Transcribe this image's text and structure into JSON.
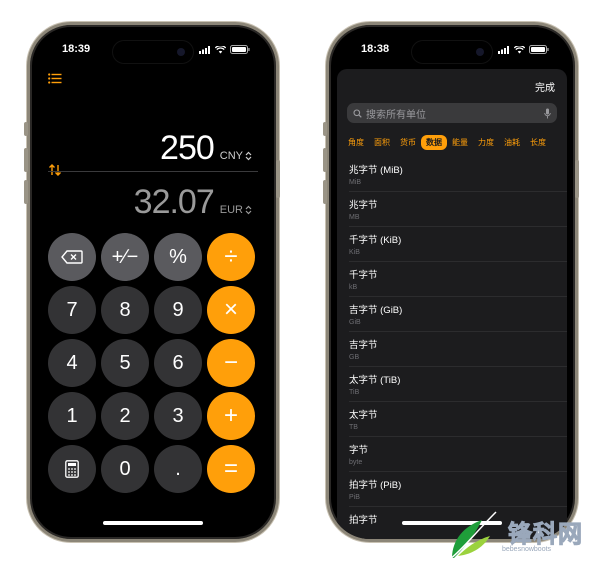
{
  "left_phone": {
    "status": {
      "time": "18:39"
    },
    "converter": {
      "source": {
        "value": "250",
        "currency": "CNY"
      },
      "target": {
        "value": "32.07",
        "currency": "EUR"
      }
    },
    "keypad": [
      {
        "label": "⌫",
        "name": "backspace-key",
        "style": "k-light"
      },
      {
        "label": "+∕−",
        "name": "plus-minus-key",
        "style": "k-light"
      },
      {
        "label": "%",
        "name": "percent-key",
        "style": "k-light"
      },
      {
        "label": "÷",
        "name": "divide-key",
        "style": "k-orange"
      },
      {
        "label": "7",
        "name": "digit-7-key",
        "style": "k-dark"
      },
      {
        "label": "8",
        "name": "digit-8-key",
        "style": "k-dark"
      },
      {
        "label": "9",
        "name": "digit-9-key",
        "style": "k-dark"
      },
      {
        "label": "×",
        "name": "multiply-key",
        "style": "k-orange"
      },
      {
        "label": "4",
        "name": "digit-4-key",
        "style": "k-dark"
      },
      {
        "label": "5",
        "name": "digit-5-key",
        "style": "k-dark"
      },
      {
        "label": "6",
        "name": "digit-6-key",
        "style": "k-dark"
      },
      {
        "label": "−",
        "name": "minus-key",
        "style": "k-orange"
      },
      {
        "label": "1",
        "name": "digit-1-key",
        "style": "k-dark"
      },
      {
        "label": "2",
        "name": "digit-2-key",
        "style": "k-dark"
      },
      {
        "label": "3",
        "name": "digit-3-key",
        "style": "k-dark"
      },
      {
        "label": "+",
        "name": "plus-key",
        "style": "k-orange"
      },
      {
        "label": "calculator-icon",
        "name": "calculator-mode-key",
        "style": "k-dark"
      },
      {
        "label": "0",
        "name": "digit-0-key",
        "style": "k-dark"
      },
      {
        "label": ".",
        "name": "decimal-key",
        "style": "k-dark"
      },
      {
        "label": "=",
        "name": "equals-key",
        "style": "k-orange"
      }
    ]
  },
  "right_phone": {
    "status": {
      "time": "18:38"
    },
    "done_label": "完成",
    "search_placeholder": "搜索所有单位",
    "categories": [
      {
        "label": "角度",
        "active": false
      },
      {
        "label": "面积",
        "active": false
      },
      {
        "label": "货币",
        "active": false
      },
      {
        "label": "数据",
        "active": true
      },
      {
        "label": "能量",
        "active": false
      },
      {
        "label": "力度",
        "active": false
      },
      {
        "label": "油耗",
        "active": false
      },
      {
        "label": "长度",
        "active": false
      }
    ],
    "units": [
      {
        "name": "兆字节 (MiB)",
        "abbr": "MiB"
      },
      {
        "name": "兆字节",
        "abbr": "MB"
      },
      {
        "name": "千字节 (KiB)",
        "abbr": "KiB"
      },
      {
        "name": "千字节",
        "abbr": "kB"
      },
      {
        "name": "吉字节 (GiB)",
        "abbr": "GiB"
      },
      {
        "name": "吉字节",
        "abbr": "GB"
      },
      {
        "name": "太字节 (TiB)",
        "abbr": "TiB"
      },
      {
        "name": "太字节",
        "abbr": "TB"
      },
      {
        "name": "字节",
        "abbr": "byte"
      },
      {
        "name": "拍字节 (PiB)",
        "abbr": "PiB"
      },
      {
        "name": "拍字节",
        "abbr": ""
      }
    ]
  },
  "watermark": {
    "text": "锋科网",
    "sub": "bebesnowboots"
  },
  "colors": {
    "accent": "#ff9f0a",
    "bg": "#000000",
    "sheet": "#1c1c1e"
  }
}
